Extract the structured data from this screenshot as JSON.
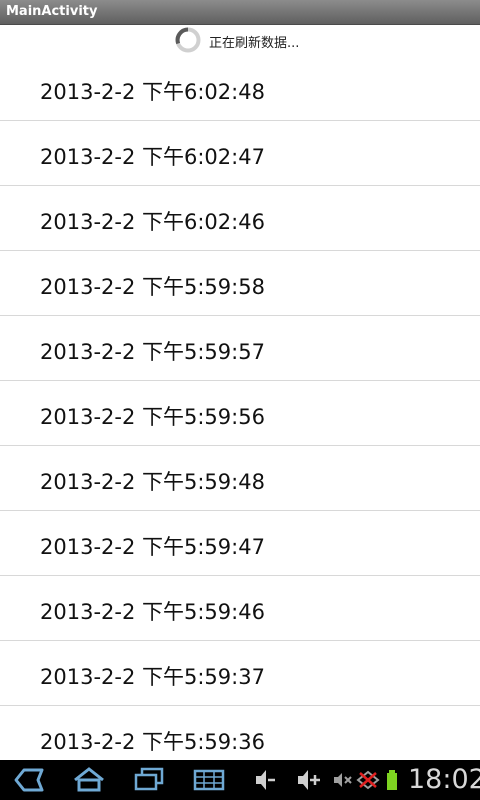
{
  "app": {
    "title": "MainActivity"
  },
  "refresh": {
    "text": "正在刷新数据..."
  },
  "list": {
    "items": [
      {
        "label": "2013-2-2  下午6:02:48"
      },
      {
        "label": "2013-2-2  下午6:02:47"
      },
      {
        "label": "2013-2-2  下午6:02:46"
      },
      {
        "label": "2013-2-2  下午5:59:58"
      },
      {
        "label": "2013-2-2  下午5:59:57"
      },
      {
        "label": "2013-2-2  下午5:59:56"
      },
      {
        "label": "2013-2-2  下午5:59:48"
      },
      {
        "label": "2013-2-2  下午5:59:47"
      },
      {
        "label": "2013-2-2  下午5:59:46"
      },
      {
        "label": "2013-2-2  下午5:59:37"
      },
      {
        "label": "2013-2-2  下午5:59:36"
      }
    ]
  },
  "statusbar": {
    "time": "18:02",
    "icons": [
      "back-icon",
      "home-icon",
      "recent-apps-icon",
      "menu-grid-icon",
      "volume-down-icon",
      "volume-up-icon",
      "mute-icon",
      "no-signal-icon",
      "battery-icon"
    ]
  },
  "colors": {
    "titlebar": "#6e6e6e",
    "accent": "#5aa3d6",
    "battery": "#7ed321"
  }
}
